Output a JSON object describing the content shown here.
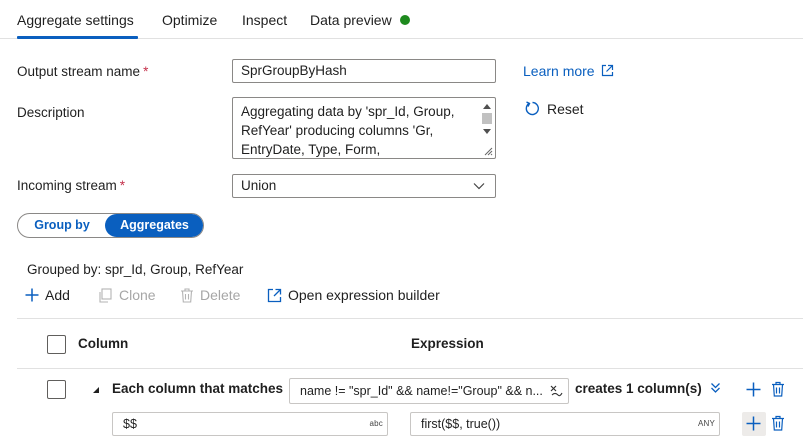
{
  "tabs": [
    {
      "label": "Aggregate settings"
    },
    {
      "label": "Optimize"
    },
    {
      "label": "Inspect"
    },
    {
      "label": "Data preview"
    }
  ],
  "form": {
    "output_stream_label": "Output stream name",
    "required_mark": "*",
    "output_stream_value": "SprGroupByHash",
    "learn_more": "Learn more",
    "description_label": "Description",
    "description_value": "Aggregating data by 'spr_Id, Group, RefYear' producing columns 'Gr, EntryDate, Type, Form, spr_new_idadm,",
    "reset_label": "Reset",
    "incoming_stream_label": "Incoming stream",
    "incoming_stream_value": "Union"
  },
  "toggle": {
    "group_by": "Group by",
    "aggregates": "Aggregates",
    "selected": "Aggregates"
  },
  "grouped_by": "Grouped by: spr_Id, Group, RefYear",
  "toolbar": {
    "add": "Add",
    "clone": "Clone",
    "delete": "Delete",
    "open_expression_builder": "Open expression builder"
  },
  "table": {
    "column_header": "Column",
    "expression_header": "Expression",
    "pattern_row": {
      "label": "Each column that matches",
      "expression": "name != \"spr_Id\" && name!=\"Group\" && n...",
      "creates": "creates 1 column(s)",
      "column_field": "$$",
      "column_type": "abc",
      "expression_field": "first($$, true())",
      "expression_type": "ANY"
    }
  },
  "colors": {
    "accent": "#0a5fbf",
    "status_green": "#1e8a1e",
    "required": "#c4314b"
  }
}
